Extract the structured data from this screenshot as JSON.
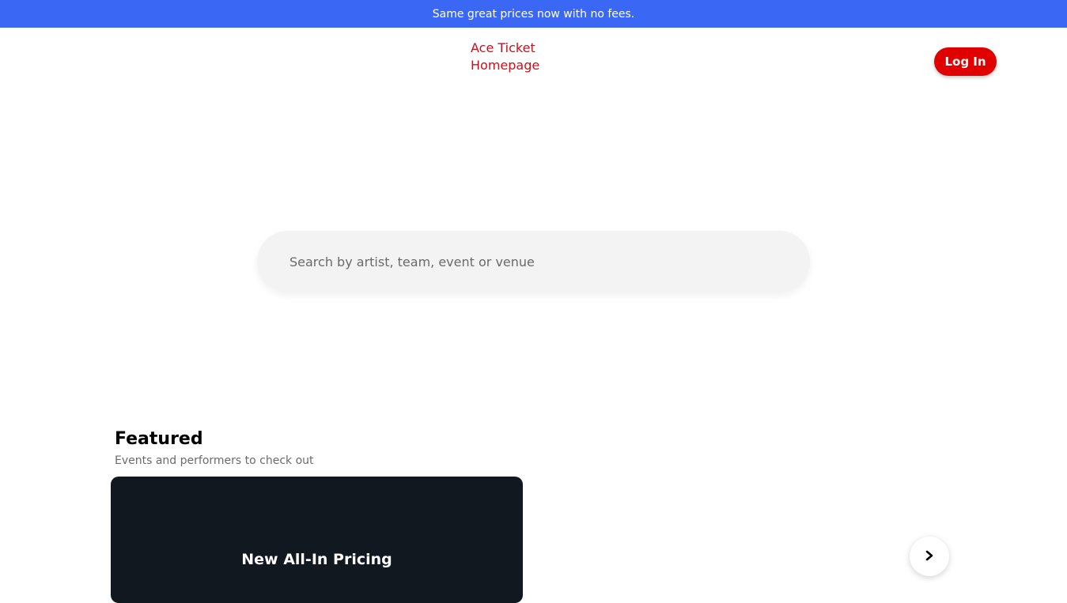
{
  "promo_bar": {
    "text": "Same great prices now with no fees."
  },
  "header": {
    "logo_alt": "Ace Ticket Homepage",
    "login_label": "Log In"
  },
  "search": {
    "placeholder": "Search by artist, team, event or venue"
  },
  "featured": {
    "title": "Featured",
    "subtitle": "Events and performers to check out",
    "cards": [
      {
        "title": "New All-In Pricing"
      }
    ],
    "next_icon": "chevron-right-icon"
  },
  "colors": {
    "promo_bg": "#3b67f5",
    "brand_red": "#e00000",
    "card_bg": "#111820"
  }
}
